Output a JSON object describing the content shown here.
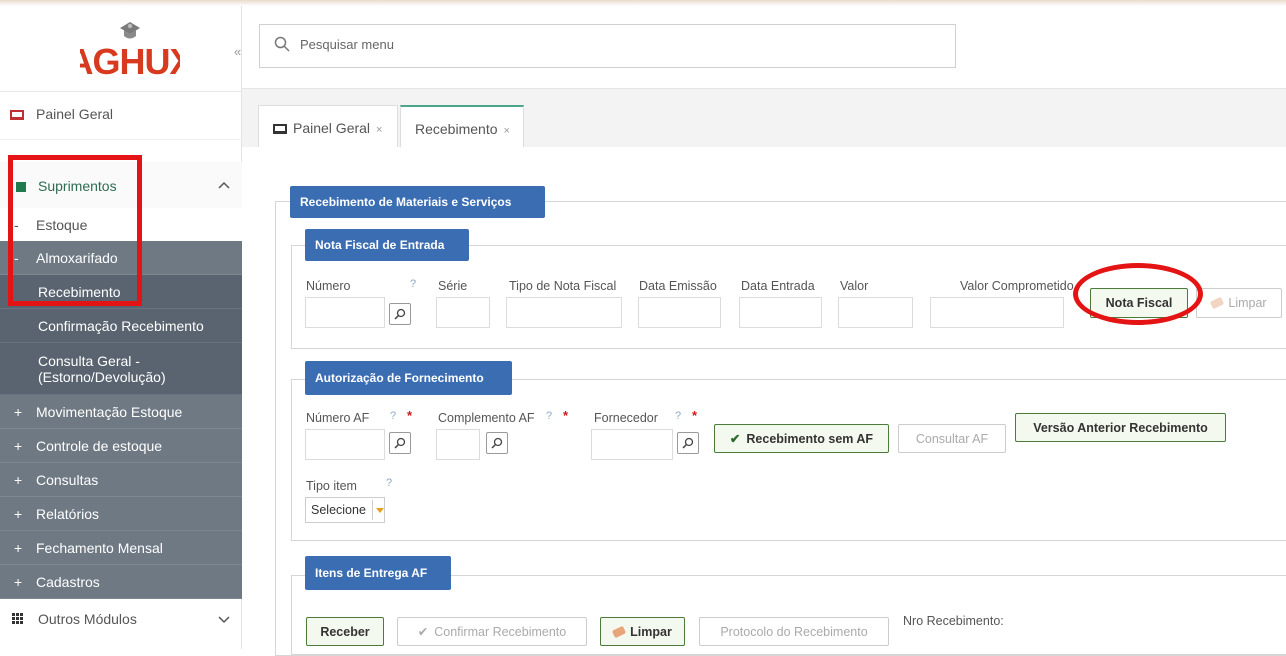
{
  "app": {
    "logo_text": "AGHUX",
    "collapse_icon": "«"
  },
  "search": {
    "placeholder": "Pesquisar menu"
  },
  "sidebar": {
    "panel": "Painel Geral",
    "suprimentos": "Suprimentos",
    "estoque": "Estoque",
    "almoxarifado": "Almoxarifado",
    "recebimento": "Recebimento",
    "confirmacao": "Confirmação Recebimento",
    "consulta_1": "Consulta Geral -",
    "consulta_2": "(Estorno/Devolução)",
    "movimentacao": "Movimentação Estoque",
    "controle": "Controle de estoque",
    "consultas": "Consultas",
    "relatorios": "Relatórios",
    "fechamento": "Fechamento Mensal",
    "cadastros": "Cadastros",
    "outros": "Outros Módulos",
    "minus": "-",
    "plus": "+"
  },
  "tabs": [
    {
      "label": "Painel Geral",
      "close": "×"
    },
    {
      "label": "Recebimento",
      "close": "×"
    }
  ],
  "form": {
    "title": "Recebimento de Materiais e Serviços",
    "nota": {
      "legend": "Nota Fiscal de Entrada",
      "numero": "Número",
      "serie": "Série",
      "tipo": "Tipo de Nota Fiscal",
      "emissao": "Data Emissão",
      "entrada": "Data Entrada",
      "valor": "Valor",
      "comprometido": "Valor Comprometido",
      "btn_nota": "Nota Fiscal",
      "btn_limpar": "Limpar"
    },
    "af": {
      "legend": "Autorização de Fornecimento",
      "numero": "Número AF",
      "complemento": "Complemento AF",
      "fornecedor": "Fornecedor",
      "btn_sem_af": "Recebimento sem AF",
      "btn_consultar": "Consultar AF",
      "btn_versao": "Versão Anterior Recebimento",
      "tipo_item": "Tipo item",
      "tipo_item_value": "Selecione"
    },
    "itens": {
      "legend": "Itens de Entrega AF",
      "btn_receber": "Receber",
      "btn_confirmar": "Confirmar Recebimento",
      "btn_limpar": "Limpar",
      "btn_protocolo": "Protocolo do Recebimento",
      "nro": "Nro Recebimento:"
    },
    "q": "?",
    "star": "*",
    "check": "✔"
  },
  "colors": {
    "accent": "#3b6db3",
    "highlight": "#e41414",
    "brand_green": "#1f7a4d"
  }
}
